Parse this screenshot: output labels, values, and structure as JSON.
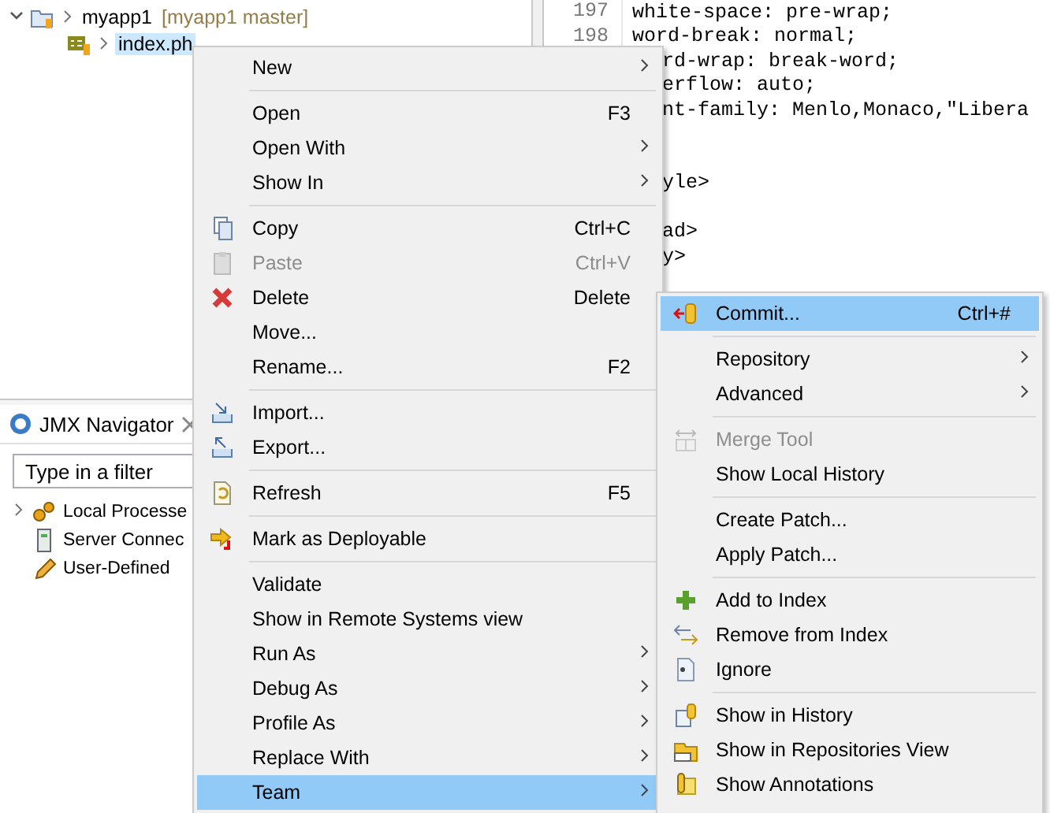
{
  "project_explorer": {
    "items": [
      {
        "label": "myapp1",
        "decoration": "[myapp1 master]",
        "expanded": true,
        "selected": false,
        "children": [
          {
            "label": "index.ph",
            "selected": true
          }
        ]
      }
    ]
  },
  "jmx_navigator": {
    "tab": {
      "label": "JMX Navigator",
      "selected": true
    },
    "filter": {
      "placeholder": "Type in a filter"
    },
    "items": [
      {
        "label": "Local Processe",
        "expandable": true
      },
      {
        "label": "Server Connec",
        "expandable": false
      },
      {
        "label": "User-Defined",
        "expandable": false
      }
    ]
  },
  "editor": {
    "lines": [
      {
        "number": "197",
        "kind": "full",
        "code": "white-space: pre-wrap;"
      },
      {
        "number": "198",
        "kind": "full",
        "code": "word-break: normal;"
      },
      {
        "kind": "partial",
        "code": "rd-wrap: break-word;"
      },
      {
        "kind": "partial",
        "code": "erflow: auto;"
      },
      {
        "kind": "partial",
        "code": "nt-family: Menlo,Monaco,\"Libera"
      },
      {
        "kind": "partial"
      },
      {
        "kind": "partial"
      },
      {
        "kind": "partial",
        "code": "yle>"
      },
      {
        "kind": "partial"
      },
      {
        "kind": "partial",
        "code": "ad>"
      },
      {
        "kind": "partial",
        "code": "y>"
      }
    ]
  },
  "context_menu": {
    "groups": [
      [
        {
          "label": "New",
          "has_submenu": true,
          "disabled": false,
          "selected": false
        }
      ],
      [
        {
          "label": "Open",
          "shortcut": "F3",
          "has_submenu": false,
          "disabled": false,
          "selected": false
        },
        {
          "label": "Open With",
          "has_submenu": true,
          "disabled": false,
          "selected": false
        },
        {
          "label": "Show In",
          "has_submenu": true,
          "disabled": false,
          "selected": false
        }
      ],
      [
        {
          "label": "Copy",
          "shortcut": "Ctrl+C",
          "has_submenu": false,
          "disabled": false,
          "selected": false
        },
        {
          "label": "Paste",
          "shortcut": "Ctrl+V",
          "has_submenu": false,
          "disabled": true,
          "selected": false
        },
        {
          "label": "Delete",
          "shortcut": "Delete",
          "has_submenu": false,
          "disabled": false,
          "selected": false
        },
        {
          "label": "Move...",
          "has_submenu": false,
          "disabled": false,
          "selected": false
        },
        {
          "label": "Rename...",
          "shortcut": "F2",
          "has_submenu": false,
          "disabled": false,
          "selected": false
        }
      ],
      [
        {
          "label": "Import...",
          "has_submenu": false,
          "disabled": false,
          "selected": false
        },
        {
          "label": "Export...",
          "has_submenu": false,
          "disabled": false,
          "selected": false
        }
      ],
      [
        {
          "label": "Refresh",
          "shortcut": "F5",
          "has_submenu": false,
          "disabled": false,
          "selected": false
        }
      ],
      [
        {
          "label": "Mark as Deployable",
          "has_submenu": false,
          "disabled": false,
          "selected": false
        }
      ],
      [
        {
          "label": "Validate",
          "has_submenu": false,
          "disabled": false,
          "selected": false
        },
        {
          "label": "Show in Remote Systems view",
          "has_submenu": false,
          "disabled": false,
          "selected": false
        },
        {
          "label": "Run As",
          "has_submenu": true,
          "disabled": false,
          "selected": false
        },
        {
          "label": "Debug As",
          "has_submenu": true,
          "disabled": false,
          "selected": false
        },
        {
          "label": "Profile As",
          "has_submenu": true,
          "disabled": false,
          "selected": false
        },
        {
          "label": "Replace With",
          "has_submenu": true,
          "disabled": false,
          "selected": false
        },
        {
          "label": "Team",
          "has_submenu": true,
          "disabled": false,
          "selected": true
        }
      ]
    ]
  },
  "team_submenu": {
    "groups": [
      [
        {
          "label": "Commit...",
          "shortcut": "Ctrl+#",
          "has_submenu": false,
          "disabled": false,
          "selected": true
        }
      ],
      [
        {
          "label": "Repository",
          "has_submenu": true,
          "disabled": false,
          "selected": false
        },
        {
          "label": "Advanced",
          "has_submenu": true,
          "disabled": false,
          "selected": false
        }
      ],
      [
        {
          "label": "Merge Tool",
          "has_submenu": false,
          "disabled": true,
          "selected": false
        },
        {
          "label": "Show Local History",
          "has_submenu": false,
          "disabled": false,
          "selected": false
        }
      ],
      [
        {
          "label": "Create Patch...",
          "has_submenu": false,
          "disabled": false,
          "selected": false
        },
        {
          "label": "Apply Patch...",
          "has_submenu": false,
          "disabled": false,
          "selected": false
        }
      ],
      [
        {
          "label": "Add to Index",
          "has_submenu": false,
          "disabled": false,
          "selected": false
        },
        {
          "label": "Remove from Index",
          "has_submenu": false,
          "disabled": false,
          "selected": false
        },
        {
          "label": "Ignore",
          "has_submenu": false,
          "disabled": false,
          "selected": false
        }
      ],
      [
        {
          "label": "Show in History",
          "has_submenu": false,
          "disabled": false,
          "selected": false
        },
        {
          "label": "Show in Repositories View",
          "has_submenu": false,
          "disabled": false,
          "selected": false
        },
        {
          "label": "Show Annotations",
          "has_submenu": false,
          "disabled": false,
          "selected": false
        }
      ]
    ]
  }
}
